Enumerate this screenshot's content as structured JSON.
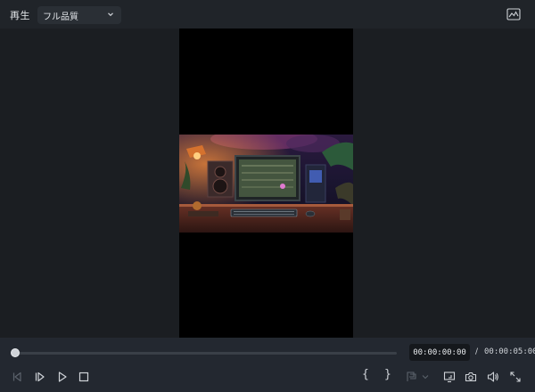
{
  "topbar": {
    "title": "再生",
    "quality_selected": "フル品質",
    "quality_icon": "chevron-down-icon",
    "chart_icon": "waveform-chart-icon"
  },
  "player": {
    "current_time": "00:00:00:00",
    "separator": "/",
    "total_time": "00:00:05:00",
    "progress": 0
  },
  "controls": {
    "icons": [
      "previous-frame-icon",
      "play-frame-icon",
      "play-icon",
      "stop-icon",
      "mark-in-icon",
      "mark-out-icon",
      "marker-icon",
      "display-icon",
      "snapshot-icon",
      "volume-icon",
      "fullscreen-icon"
    ],
    "mark_in": "{",
    "mark_out": "}"
  },
  "colors": {
    "background": "#1b1e22",
    "topbar": "#202429",
    "controlbar": "#232830",
    "icon": "#cfd3d8",
    "icon_disabled": "#5b626b"
  }
}
